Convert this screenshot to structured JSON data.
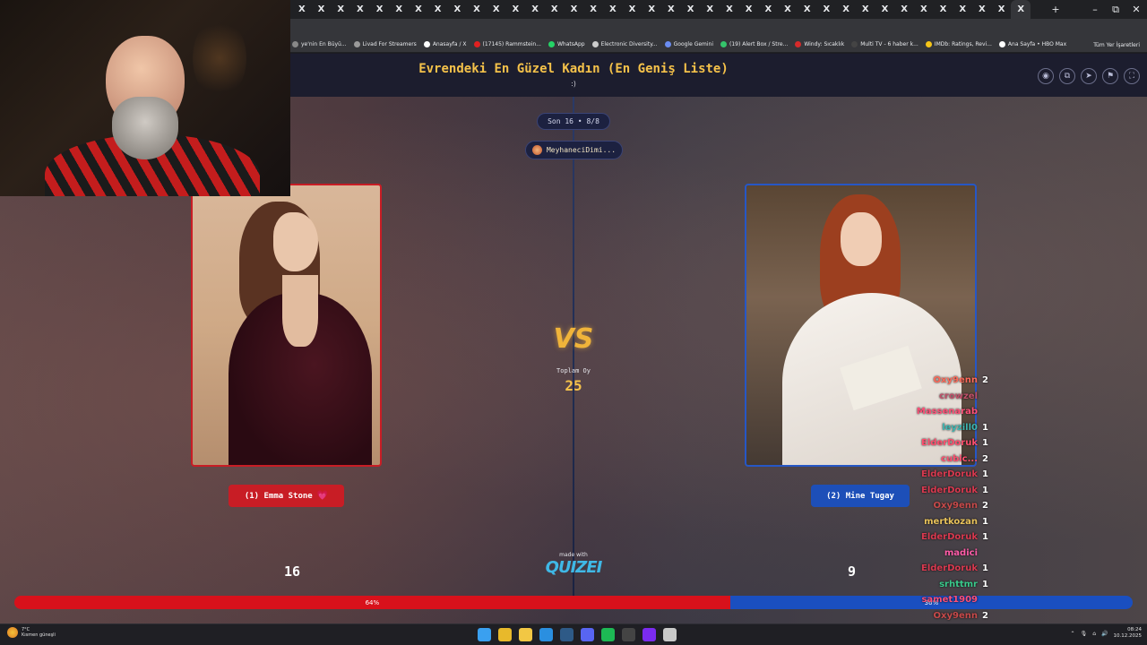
{
  "browser": {
    "tab_close_glyph": "X",
    "tab_count": 38,
    "new_tab_glyph": "+",
    "window_controls": [
      "–",
      "⧉",
      "✕"
    ],
    "bookmarks": [
      {
        "label": "ye'nin En Büyü...",
        "color": "#888888"
      },
      {
        "label": "Livad For Streamers",
        "color": "#9a9a9a"
      },
      {
        "label": "Anasayfa / X",
        "color": "#ffffff"
      },
      {
        "label": "(17145) Rammstein...",
        "color": "#e02020"
      },
      {
        "label": "WhatsApp",
        "color": "#25d366"
      },
      {
        "label": "Electronic Diversity...",
        "color": "#cccccc"
      },
      {
        "label": "Google Gemini",
        "color": "#6a8cf0"
      },
      {
        "label": "(19) Alert Box / Stre...",
        "color": "#35c46b"
      },
      {
        "label": "Windy: Sıcaklık",
        "color": "#d52a2a"
      },
      {
        "label": "Multi TV - 6 haber k...",
        "color": "#444444"
      },
      {
        "label": "IMDb: Ratings, Revi...",
        "color": "#f5c518"
      },
      {
        "label": "Ana Sayfa • HBO Max",
        "color": "#ffffff"
      }
    ],
    "all_bookmarks_label": "Tüm Yer İşaretleri"
  },
  "quiz": {
    "title": "Evrendeki En Güzel Kadın (En Geniş Liste)",
    "subtitle": ":)",
    "round_badge": "Son 16 • 8/8",
    "user_name": "MeyhaneciDimi...",
    "header_icons": [
      "eye-icon",
      "copy-icon",
      "send-icon",
      "flag-icon",
      "fullscreen-icon"
    ],
    "header_icon_glyphs": [
      "◉",
      "⧉",
      "➤",
      "⚑",
      "⛶"
    ],
    "vs_label": "VS",
    "total_label": "Toplam Oy",
    "total_value": "25",
    "made_with": "made with",
    "brand": "QUIZEI",
    "left": {
      "button_label": "(1) Emma Stone",
      "heart": "💗",
      "score": "16",
      "percent": "64%",
      "percent_value": 64,
      "color": "#c81d25"
    },
    "right": {
      "button_label": "(2) Mine Tugay",
      "score": "9",
      "percent": "36%",
      "percent_value": 36,
      "color": "#1d4fb8"
    }
  },
  "chat": [
    {
      "user": "Oxy9enn",
      "msg": "2",
      "color": "#ff6a5a"
    },
    {
      "user": "crowzel",
      "msg": "",
      "color": "#c0506a"
    },
    {
      "user": "Massenarab",
      "msg": "",
      "color": "#ff5078"
    },
    {
      "user": "leyzill0",
      "msg": "1",
      "color": "#3db7b3"
    },
    {
      "user": "ElderDoruk",
      "msg": "1",
      "color": "#ff4f6f"
    },
    {
      "user": "cubic...",
      "msg": "2",
      "color": "#ff4f6f"
    },
    {
      "user": "ElderDoruk",
      "msg": "1",
      "color": "#d9394f"
    },
    {
      "user": "ElderDoruk",
      "msg": "1",
      "color": "#d9394f"
    },
    {
      "user": "Oxy9enn",
      "msg": "2",
      "color": "#c74a4a"
    },
    {
      "user": "mertkozan",
      "msg": "1",
      "color": "#e8c25a"
    },
    {
      "user": "ElderDoruk",
      "msg": "1",
      "color": "#d9394f"
    },
    {
      "user": "madici",
      "msg": "",
      "color": "#ff5ca8"
    },
    {
      "user": "ElderDoruk",
      "msg": "1",
      "color": "#d9394f"
    },
    {
      "user": "srhttmr",
      "msg": "1",
      "color": "#39c98b"
    },
    {
      "user": "samet1909",
      "msg": "",
      "color": "#ff5078"
    },
    {
      "user": "Oxy9enn",
      "msg": "2",
      "color": "#c74a4a"
    }
  ],
  "taskbar": {
    "weather_temp": "7°C",
    "weather_desc": "Kısmen güneşli",
    "time": "08:24",
    "date": "10.12.2025",
    "apps": [
      {
        "name": "windows-start-icon",
        "color": "#3aa0f0"
      },
      {
        "name": "chrome-icon",
        "color": "#e8b92b"
      },
      {
        "name": "file-explorer-icon",
        "color": "#f2c744"
      },
      {
        "name": "edge-icon",
        "color": "#2a8fe0"
      },
      {
        "name": "steam-icon",
        "color": "#2e5a87"
      },
      {
        "name": "discord-icon",
        "color": "#5865f2"
      },
      {
        "name": "spotify-icon",
        "color": "#1db954"
      },
      {
        "name": "obs-icon",
        "color": "#444444"
      },
      {
        "name": "app-icon",
        "color": "#7b2bf0"
      },
      {
        "name": "settings-icon",
        "color": "#c9c9c9"
      }
    ]
  }
}
